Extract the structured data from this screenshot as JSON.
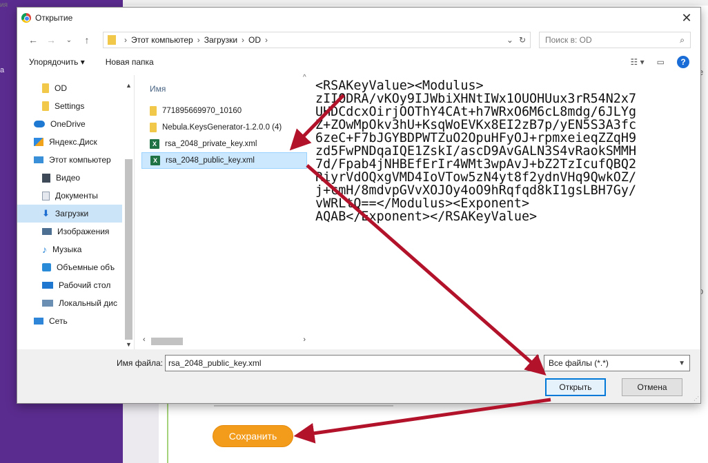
{
  "background": {
    "save_button": "Сохранить",
    "sidebar_stub": "а",
    "right_stub_1": "е",
    "right_stub_2": "о",
    "top_stub": "ия"
  },
  "dialog": {
    "title": "Открытие",
    "close": "✕",
    "nav": {
      "back": "←",
      "forward": "→",
      "recent": "⌄",
      "up": "↑"
    },
    "breadcrumb": [
      "Этот компьютер",
      "Загрузки",
      "OD"
    ],
    "breadcrumb_separator": "›",
    "address_dropdown": "⌄",
    "refresh": "↻",
    "search_placeholder": "Поиск в: OD",
    "search_icon": "⌕",
    "toolbar": {
      "organize": "Упорядочить ▾",
      "new_folder": "Новая папка",
      "view_icon": "☷ ▾",
      "pane_icon": "▭",
      "help": "?"
    },
    "nav_pane": [
      {
        "label": "OD",
        "icon": "folder",
        "indent": 2
      },
      {
        "label": "Settings",
        "icon": "folder",
        "indent": 2
      },
      {
        "label": "OneDrive",
        "icon": "cloud",
        "indent": 1
      },
      {
        "label": "Яндекс.Диск",
        "icon": "yadisk",
        "indent": 1
      },
      {
        "label": "Этот компьютер",
        "icon": "pc",
        "indent": 1
      },
      {
        "label": "Видео",
        "icon": "video",
        "indent": 2
      },
      {
        "label": "Документы",
        "icon": "doc",
        "indent": 2
      },
      {
        "label": "Загрузки",
        "icon": "down",
        "indent": 2,
        "selected": true
      },
      {
        "label": "Изображения",
        "icon": "img",
        "indent": 2
      },
      {
        "label": "Музыка",
        "icon": "music",
        "indent": 2
      },
      {
        "label": "Объемные объ",
        "icon": "obj",
        "indent": 2
      },
      {
        "label": "Рабочий стол",
        "icon": "desk",
        "indent": 2
      },
      {
        "label": "Локальный дис",
        "icon": "drive",
        "indent": 2
      },
      {
        "label": "Сеть",
        "icon": "net",
        "indent": 1
      }
    ],
    "column_header": "Имя",
    "files": [
      {
        "name": "771895669970_10160",
        "icon": "folder"
      },
      {
        "name": "Nebula.KeysGenerator-1.2.0.0 (4)",
        "icon": "folder"
      },
      {
        "name": "rsa_2048_private_key.xml",
        "icon": "excel"
      },
      {
        "name": "rsa_2048_public_key.xml",
        "icon": "excel",
        "selected": true
      }
    ],
    "preview_lines": [
      "<RSAKeyValue><Modulus>",
      "zIIODRA/vKOy9IJWbiXHNtIWx1OUOHUux3rR54N2x7",
      "UHDCdcxOirjOOThY4CAt+h7WRxO6M6cL8mdg/6JLYg",
      "Z+ZOwMpOkv3hU+KsqWoEVKx8EI2zB7p/yEN5S3A3fc",
      "6zeC+F7bJGYBDPWTZuO2OpuHFyOJ+rpmxeieqZZqH9",
      "zd5FwPNDqaIQE1ZskI/ascD9AvGALN3S4vRaokSMMH",
      "7d/Fpab4jNHBEfErIr4WMt3wpAvJ+bZ2TzIcufQBQ2",
      "RiyrVdOQxgVMD4IoVTow5zN4yt8f2ydnVHq9QwkOZ/",
      "j+cmH/8mdvpGVvXOJOy4oO9hRqfqd8kI1gsLBH7Gy/",
      "vWRLtQ==</Modulus><Exponent>",
      "AQAB</Exponent></RSAKeyValue>"
    ],
    "filename_label": "Имя файла:",
    "filename_value": "rsa_2048_public_key.xml",
    "filter_value": "Все файлы (*.*)",
    "open_button": "Открыть",
    "cancel_button": "Отмена"
  },
  "colors": {
    "accent": "#0078d7",
    "annotation_arrow": "#b3122b",
    "save_button": "#f39c1c",
    "background_sidebar": "#5b2c8f"
  }
}
